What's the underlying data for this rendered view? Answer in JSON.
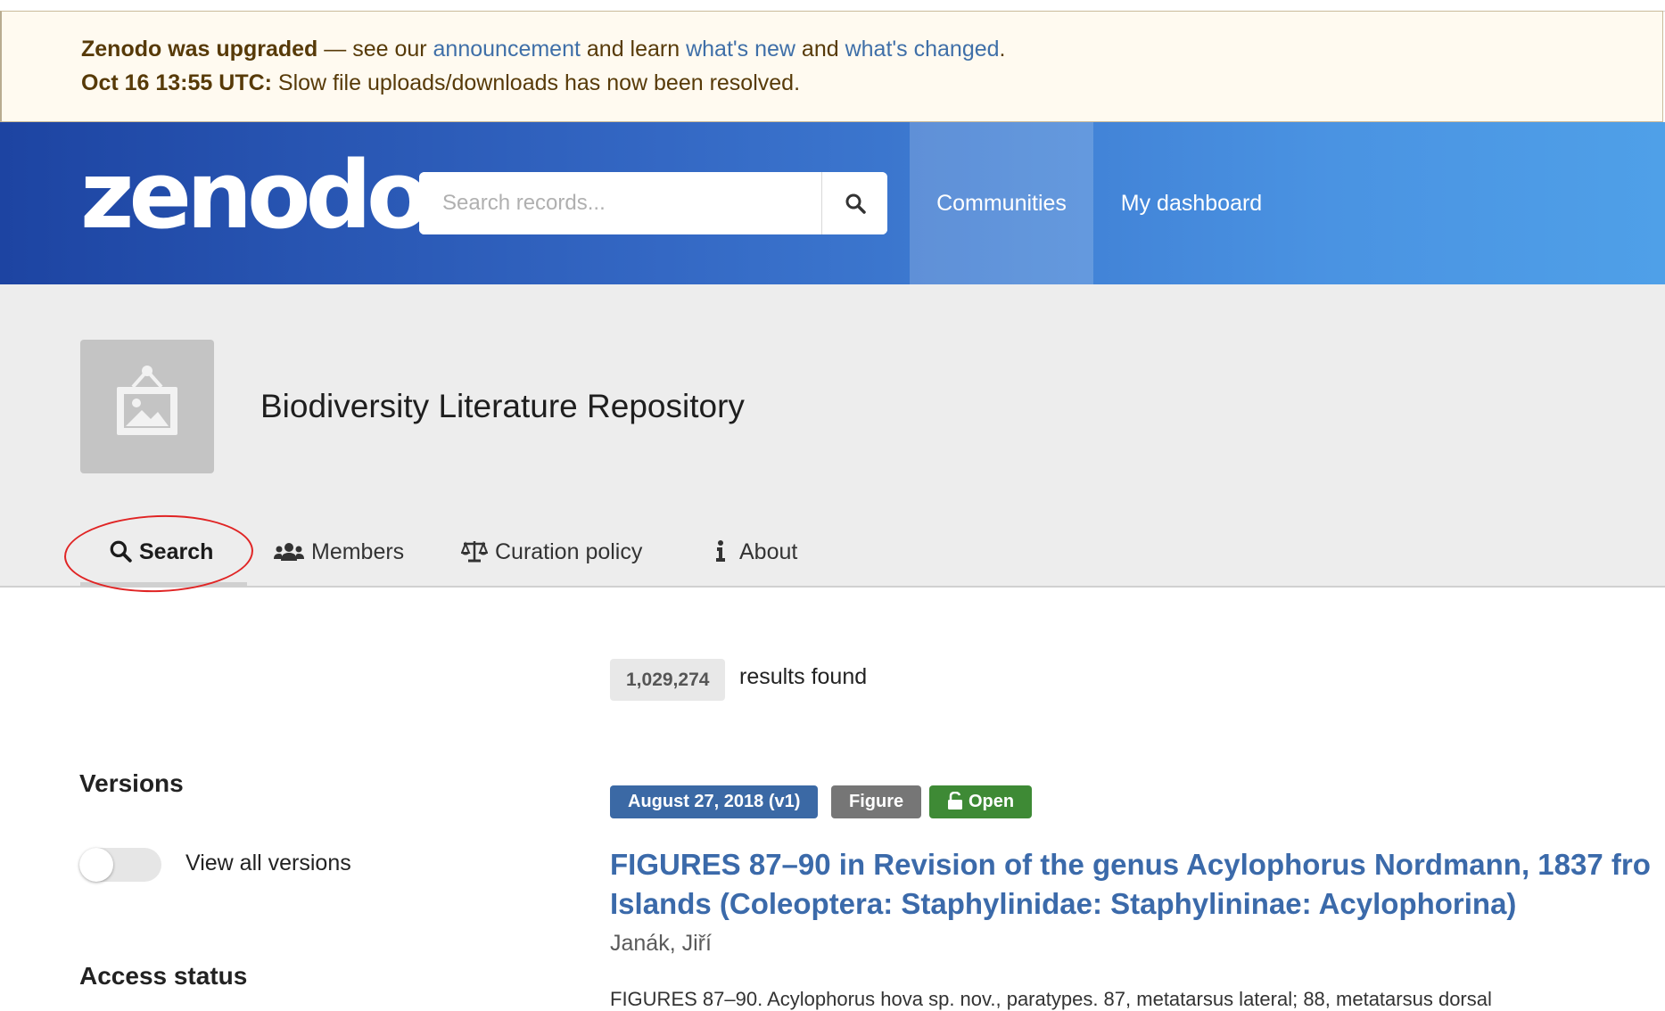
{
  "banner": {
    "line1_bold": "Zenodo was upgraded",
    "line1_text1": " — see our ",
    "link_announcement": "announcement",
    "line1_text2": " and learn ",
    "link_whats_new": "what's new",
    "line1_text3": " and ",
    "link_whats_changed": "what's changed",
    "line1_end": ".",
    "line2_bold": "Oct 16 13:55 UTC:",
    "line2_text": " Slow file uploads/downloads has now been resolved."
  },
  "header": {
    "logo": "zenodo",
    "search_placeholder": "Search records...",
    "nav": {
      "communities": "Communities",
      "dashboard": "My dashboard"
    }
  },
  "community": {
    "title": "Biodiversity Literature Repository",
    "tabs": {
      "search": "Search",
      "members": "Members",
      "curation": "Curation policy",
      "about": "About"
    }
  },
  "results": {
    "count": "1,029,274",
    "count_text": "results found"
  },
  "facets": {
    "versions_title": "Versions",
    "view_all_versions": "View all versions",
    "access_status_title": "Access status"
  },
  "result": {
    "date_label": "August 27, 2018 (v1)",
    "type_label": "Figure",
    "access_label": "Open",
    "title_line1": "FIGURES 87–90 in Revision of the genus Acylophorus Nordmann, 1837 fro",
    "title_line2": "Islands (Coleoptera: Staphylinidae: Staphylininae: Acylophorina)",
    "author": "Janák, Jiří",
    "description": "FIGURES 87–90. Acylophorus hova sp. nov., paratypes. 87, metatarsus lateral; 88, metatarsus dorsal"
  },
  "colors": {
    "header_start": "#1d44a2",
    "header_end": "#4fa0e8",
    "link": "#3b6aaa",
    "date_label": "#3b69a5",
    "open_label": "#3e8a35",
    "annotation": "#e02424"
  }
}
